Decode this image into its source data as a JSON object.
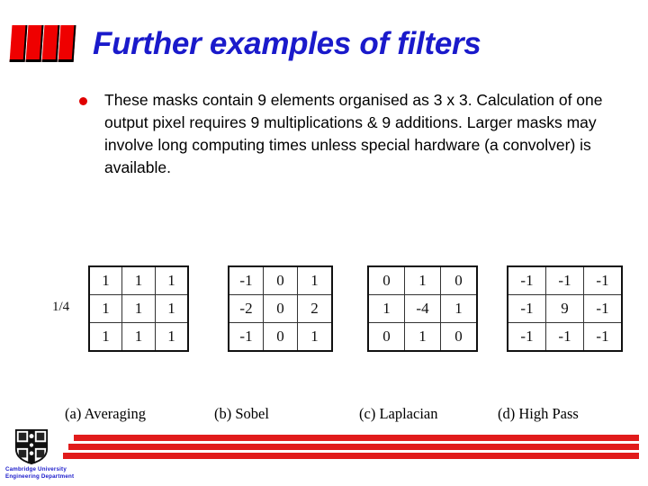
{
  "slide": {
    "title": "Further examples of filters",
    "title_color": "#1a1acb",
    "logo_color": "#ef0000"
  },
  "body": {
    "bullet_icon": "bullet-dot",
    "text": "These masks contain 9 elements organised as 3 x 3.  Calculation of one output pixel requires 9 multiplications & 9 additions.  Larger masks may involve long computing times unless special hardware (a convolver) is available."
  },
  "matrices": [
    {
      "name": "averaging",
      "scale": "1/4",
      "rows": [
        [
          "1",
          "1",
          "1"
        ],
        [
          "1",
          "1",
          "1"
        ],
        [
          "1",
          "1",
          "1"
        ]
      ],
      "caption": "(a)  Averaging"
    },
    {
      "name": "sobel",
      "scale": "",
      "rows": [
        [
          "-1",
          "0",
          "1"
        ],
        [
          "-2",
          "0",
          "2"
        ],
        [
          "-1",
          "0",
          "1"
        ]
      ],
      "caption": "(b)  Sobel"
    },
    {
      "name": "laplacian",
      "scale": "",
      "rows": [
        [
          "0",
          "1",
          "0"
        ],
        [
          "1",
          "-4",
          "1"
        ],
        [
          "0",
          "1",
          "0"
        ]
      ],
      "caption": "(c)  Laplacian"
    },
    {
      "name": "high-pass",
      "scale": "",
      "rows": [
        [
          "-1",
          "-1",
          "-1"
        ],
        [
          "-1",
          "9",
          "-1"
        ],
        [
          "-1",
          "-1",
          "-1"
        ]
      ],
      "caption": "(d)  High Pass"
    }
  ],
  "footer": {
    "crest_icon": "cambridge-crest",
    "org_line1": "Cambridge University",
    "org_line2": "Engineering Department",
    "org_color": "#1a1acb",
    "stripe_color": "#e11b1b"
  }
}
